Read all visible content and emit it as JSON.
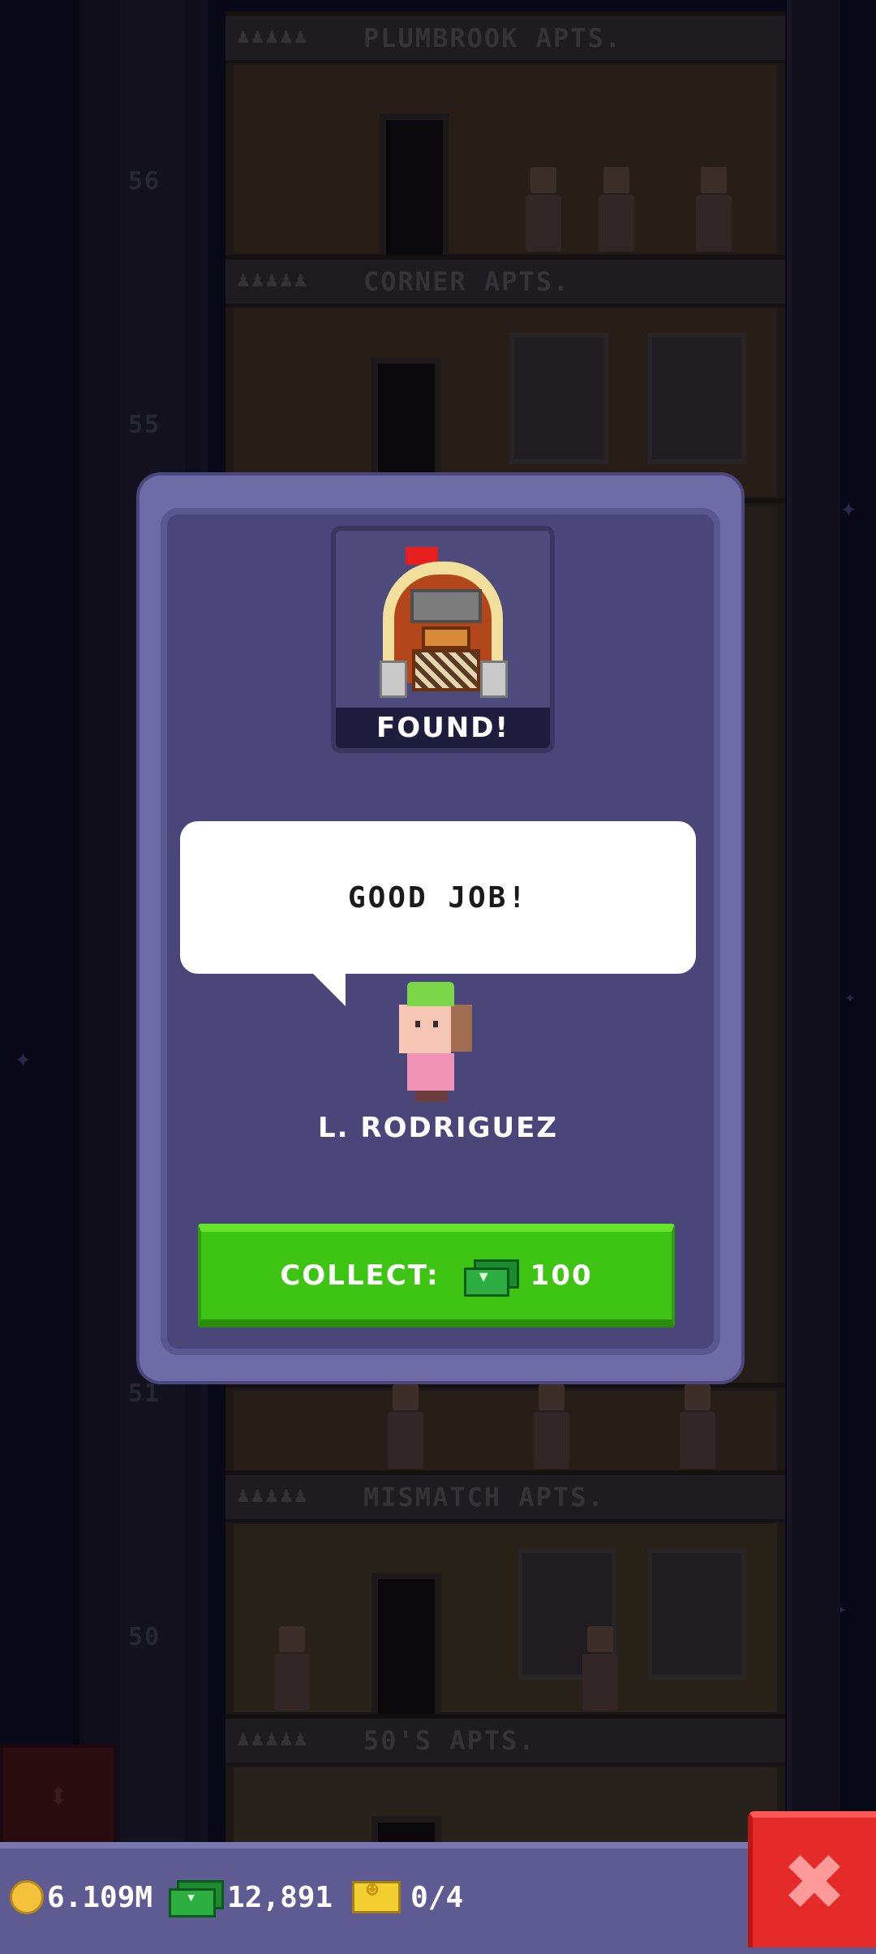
{
  "tower": {
    "floors": [
      {
        "name": "PLUMBROOK APTS.",
        "stars": "♟♟♟♟♟"
      },
      {
        "name": "CORNER APTS.",
        "stars": "♟♟♟♟♟"
      },
      {
        "name": "MISMATCH APTS.",
        "stars": "♟♟♟♟♟"
      },
      {
        "name": "50'S APTS.",
        "stars": "♟♟♟♟♟"
      }
    ],
    "floor_numbers": [
      "56",
      "55",
      "51",
      "50"
    ]
  },
  "modal": {
    "found_label": "FOUND!",
    "item_icon": "jukebox-icon",
    "speech": "GOOD JOB!",
    "character_name": "L. RODRIGUEZ",
    "collect_label": "COLLECT:",
    "collect_amount": "100"
  },
  "hud": {
    "coins": "6.109M",
    "bux": "12,891",
    "tickets": "0/4"
  },
  "colors": {
    "modal_bg": "#4b4679",
    "modal_border": "#6f6ba6",
    "collect_green": "#3ec413",
    "close_red": "#e52a2a",
    "hud_bg": "#5e5a92"
  }
}
